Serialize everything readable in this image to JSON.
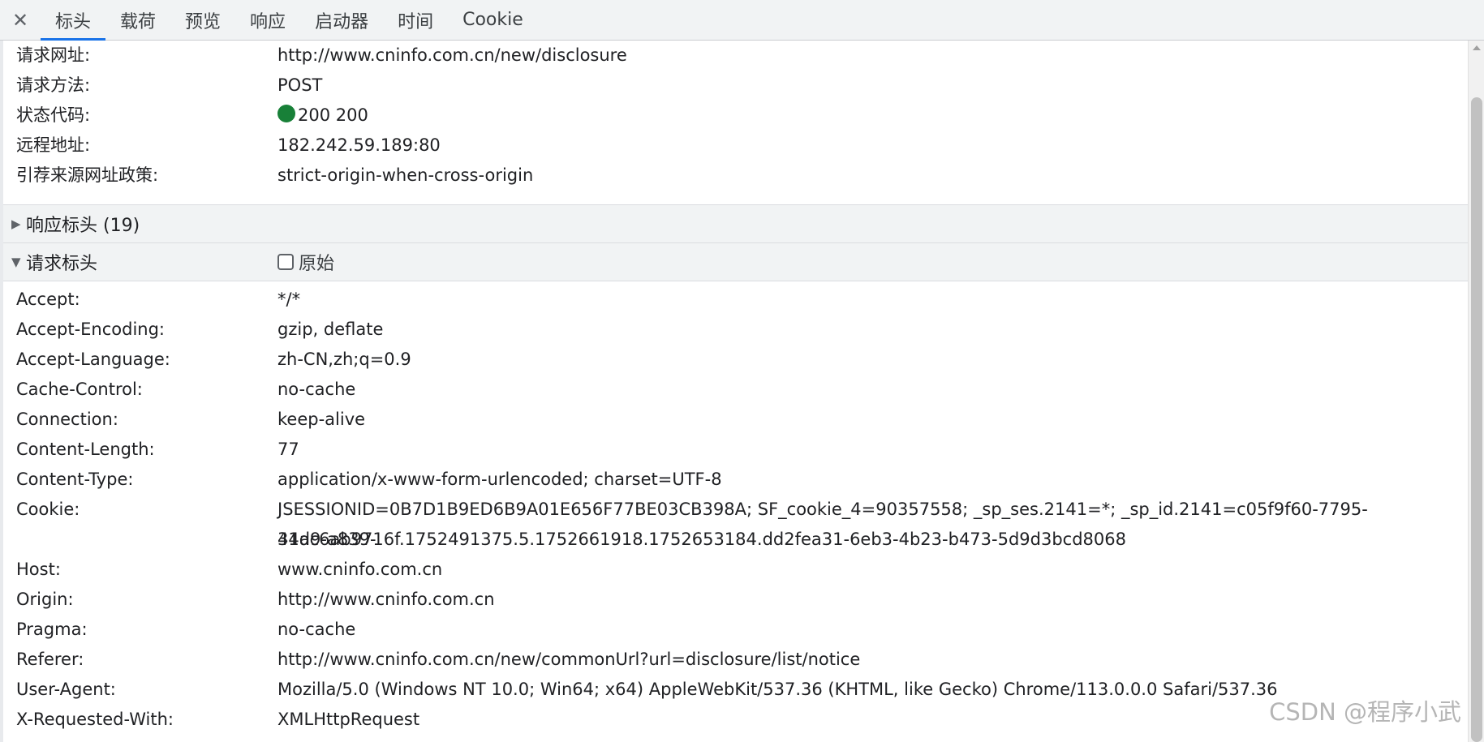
{
  "tabs": {
    "close": "✕",
    "items": [
      "标头",
      "载荷",
      "预览",
      "响应",
      "启动器",
      "时间",
      "Cookie"
    ],
    "active": 0
  },
  "general": {
    "url_key": "请求网址:",
    "url_val": "http://www.cninfo.com.cn/new/disclosure",
    "method_key": "请求方法:",
    "method_val": "POST",
    "status_key": "状态代码:",
    "status_val": "200 200",
    "status_color": "#188038",
    "remote_key": "远程地址:",
    "remote_val": "182.242.59.189:80",
    "referrer_key": "引荐来源网址政策:",
    "referrer_val": "strict-origin-when-cross-origin"
  },
  "response_headers": {
    "title": "响应标头 (19)",
    "collapsed": true
  },
  "request_headers": {
    "title": "请求标头",
    "raw_label": "原始",
    "raw_checked": false,
    "rows": [
      {
        "k": "Accept:",
        "v": "*/*"
      },
      {
        "k": "Accept-Encoding:",
        "v": "gzip, deflate"
      },
      {
        "k": "Accept-Language:",
        "v": "zh-CN,zh;q=0.9"
      },
      {
        "k": "Cache-Control:",
        "v": "no-cache"
      },
      {
        "k": "Connection:",
        "v": "keep-alive"
      },
      {
        "k": "Content-Length:",
        "v": "77"
      },
      {
        "k": "Content-Type:",
        "v": "application/x-www-form-urlencoded; charset=UTF-8"
      },
      {
        "k": "Cookie:",
        "v": "JSESSIONID=0B7D1B9ED6B9A01E656F77BE03CB398A; SF_cookie_4=90357558; _sp_ses.2141=*; _sp_id.2141=c05f9f60-7795-41d9-a839-",
        "v2": "34ac6ab9716f.1752491375.5.1752661918.1752653184.dd2fea31-6eb3-4b23-b473-5d9d3bcd8068"
      },
      {
        "k": "Host:",
        "v": "www.cninfo.com.cn"
      },
      {
        "k": "Origin:",
        "v": "http://www.cninfo.com.cn"
      },
      {
        "k": "Pragma:",
        "v": "no-cache"
      },
      {
        "k": "Referer:",
        "v": "http://www.cninfo.com.cn/new/commonUrl?url=disclosure/list/notice"
      },
      {
        "k": "User-Agent:",
        "v": "Mozilla/5.0 (Windows NT 10.0; Win64; x64) AppleWebKit/537.36 (KHTML, like Gecko) Chrome/113.0.0.0 Safari/537.36"
      },
      {
        "k": "X-Requested-With:",
        "v": "XMLHttpRequest"
      }
    ]
  },
  "watermark": "CSDN @程序小武"
}
